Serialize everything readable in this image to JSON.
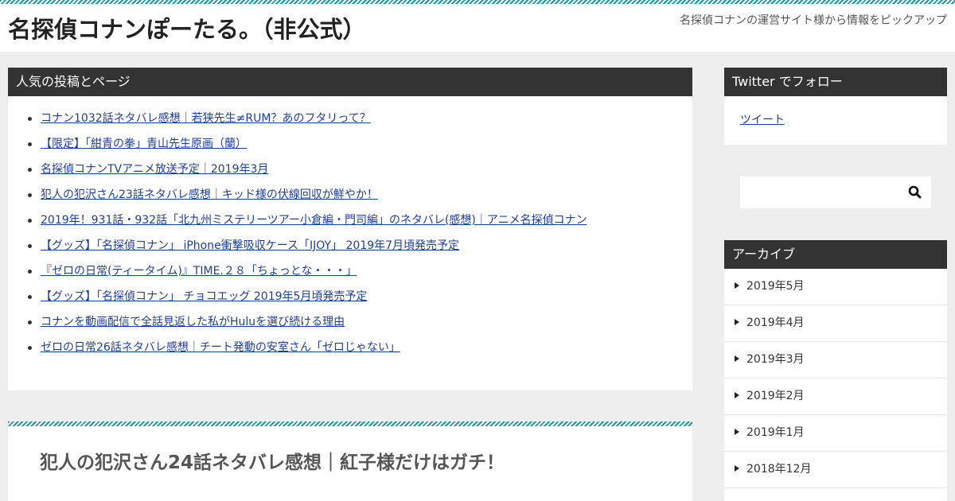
{
  "header": {
    "site_title": "名探偵コナンぽーたる。（非公式）",
    "tagline": "名探偵コナンの運営サイト様から情報をピックアップ"
  },
  "popular": {
    "heading": "人気の投稿とページ",
    "items": [
      "コナン1032話ネタバレ感想｜若狭先生≠RUM？あのフタリって？",
      "【限定】「紺青の拳」青山先生原画（蘭）",
      "名探偵コナンTVアニメ放送予定｜2019年3月",
      "犯人の犯沢さん23話ネタバレ感想｜キッド様の伏線回収が鮮やか！",
      "2019年！931話・932話「北九州ミステリーツアー小倉編・門司編」のネタバレ(感想)｜アニメ名探偵コナン",
      "【グッズ】「名探偵コナン」 iPhone衝撃吸収ケース「IJOY」 2019年7月頃発売予定",
      "『ゼロの日常(ティータイム)』TIME.２８「ちょっとな・・・」",
      "【グッズ】「名探偵コナン」 チョコエッグ 2019年5月頃発売予定",
      "コナンを動画配信で全話見返した私がHuluを選び続ける理由",
      "ゼロの日常26話ネタバレ感想｜チート発動の安室さん「ゼロじゃない」"
    ]
  },
  "article": {
    "title": "犯人の犯沢さん24話ネタバレ感想｜紅子様だけはガチ！"
  },
  "sidebar": {
    "twitter_heading": "Twitter でフォロー",
    "tweet_label": "ツイート",
    "search_placeholder": "",
    "search_icon": "search-icon",
    "archive_heading": "アーカイブ",
    "archive_items": [
      "2019年5月",
      "2019年4月",
      "2019年3月",
      "2019年2月",
      "2019年1月",
      "2018年12月"
    ]
  },
  "colors": {
    "accent": "#1a9aa0",
    "widget_header": "#333333",
    "link": "#1a3ea8",
    "background": "#eeeeee"
  }
}
